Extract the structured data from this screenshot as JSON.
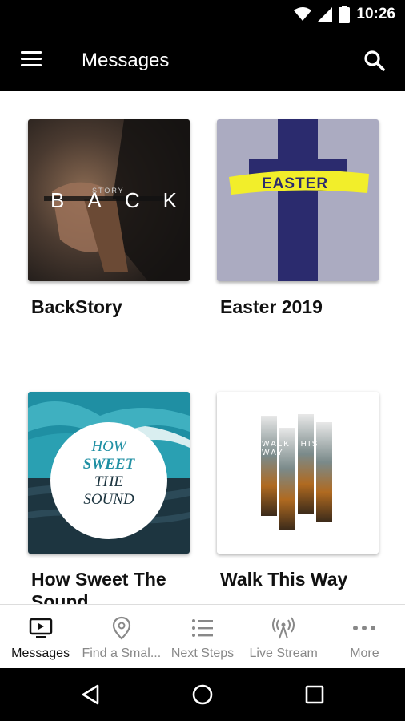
{
  "status_bar": {
    "time": "10:26"
  },
  "app_bar": {
    "title": "Messages"
  },
  "messages": [
    {
      "title": "BackStory",
      "art_text": "BACK",
      "art_subtext": "STORY"
    },
    {
      "title": "Easter 2019",
      "art_text": "EASTER"
    },
    {
      "title": "How Sweet The Sound",
      "art_lines": [
        "HOW",
        "SWEET",
        "THE",
        "SOUND"
      ]
    },
    {
      "title": "Walk This Way",
      "art_text": "WALK THIS WAY"
    }
  ],
  "bottom_nav": [
    {
      "label": "Messages",
      "icon": "tv-play-icon",
      "active": true
    },
    {
      "label": "Find a Smal...",
      "icon": "location-pin-icon"
    },
    {
      "label": "Next Steps",
      "icon": "list-icon"
    },
    {
      "label": "Live Stream",
      "icon": "broadcast-icon"
    },
    {
      "label": "More",
      "icon": "more-dots-icon"
    }
  ],
  "colors": {
    "bar_bg": "#000000",
    "active": "#111111",
    "inactive": "#888888",
    "easter_yellow": "#f2ee2a",
    "cross": "#2a2a6b",
    "ocean": "#1f8fa3"
  }
}
